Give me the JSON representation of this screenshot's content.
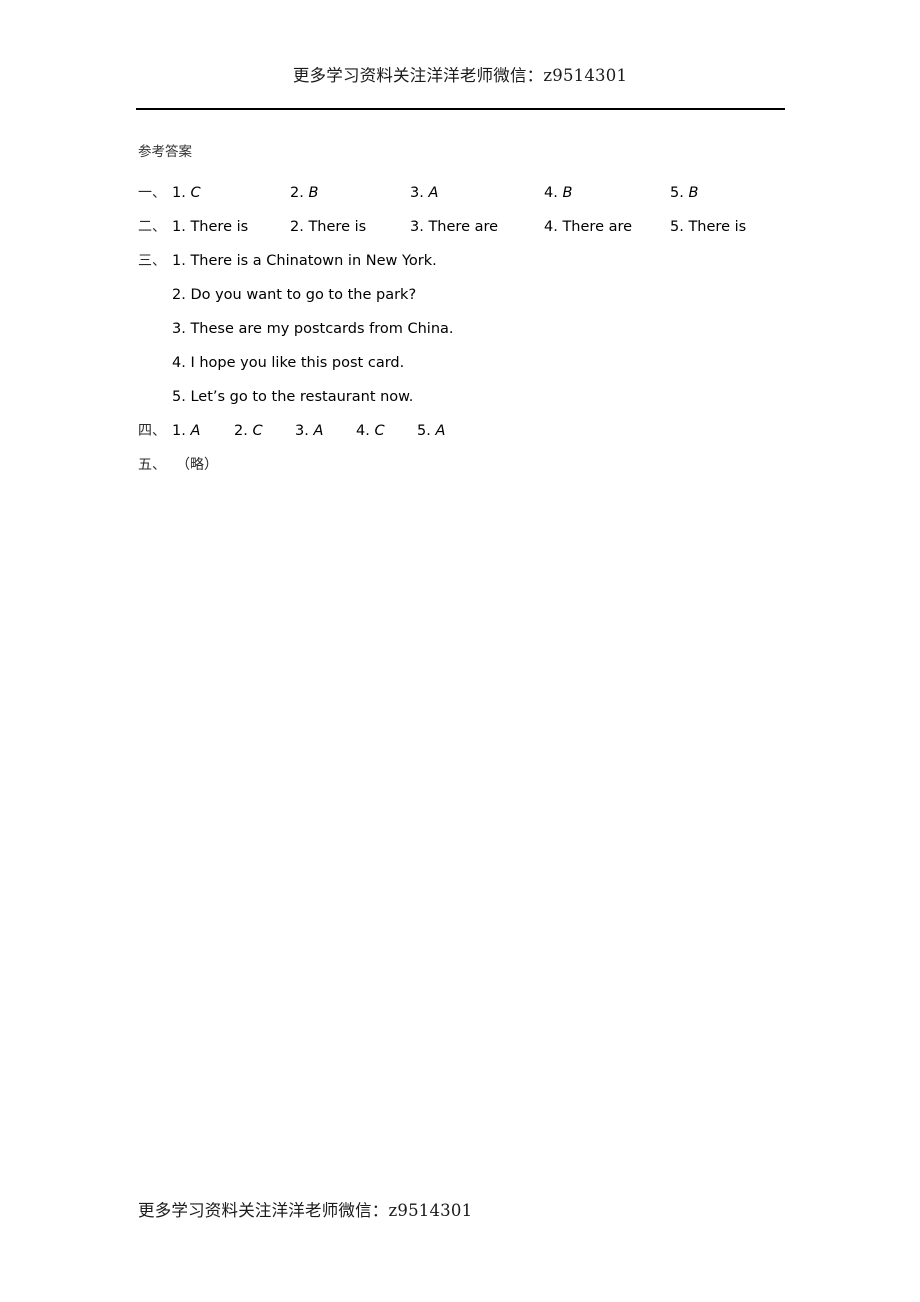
{
  "header": {
    "promo_text": "更多学习资料关注洋洋老师微信：z9514301"
  },
  "footer": {
    "promo_text": "更多学习资料关注洋洋老师微信：z9514301"
  },
  "document": {
    "title": "参考答案",
    "sections": [
      {
        "marker": "一、",
        "type": "inline",
        "items": [
          {
            "num": "1.",
            "value": "C"
          },
          {
            "num": "2.",
            "value": "B"
          },
          {
            "num": "3.",
            "value": "A"
          },
          {
            "num": "4.",
            "value": "B"
          },
          {
            "num": "5.",
            "value": "B"
          }
        ]
      },
      {
        "marker": "二、",
        "type": "inline",
        "items": [
          {
            "num": "1.",
            "value": "There is"
          },
          {
            "num": "2.",
            "value": "There is"
          },
          {
            "num": "3.",
            "value": "There are"
          },
          {
            "num": "4.",
            "value": "There are"
          },
          {
            "num": "5.",
            "value": "There is"
          }
        ]
      },
      {
        "marker": "三、",
        "type": "stacked",
        "items": [
          {
            "num": "1.",
            "value": "There is a Chinatown in New York."
          },
          {
            "num": "2.",
            "value": "Do you want to go to the park?"
          },
          {
            "num": "3.",
            "value": "These are my postcards from China."
          },
          {
            "num": "4.",
            "value": "I hope you like this post card."
          },
          {
            "num": "5.",
            "value": "Let’s go to the restaurant now."
          }
        ]
      },
      {
        "marker": "四、",
        "type": "inline",
        "items": [
          {
            "num": "1.",
            "value": "A"
          },
          {
            "num": "2.",
            "value": "C"
          },
          {
            "num": "3.",
            "value": "A"
          },
          {
            "num": "4.",
            "value": "C"
          },
          {
            "num": "5.",
            "value": "A"
          }
        ]
      },
      {
        "marker": "五、",
        "type": "plain",
        "text": "（略）"
      }
    ]
  }
}
